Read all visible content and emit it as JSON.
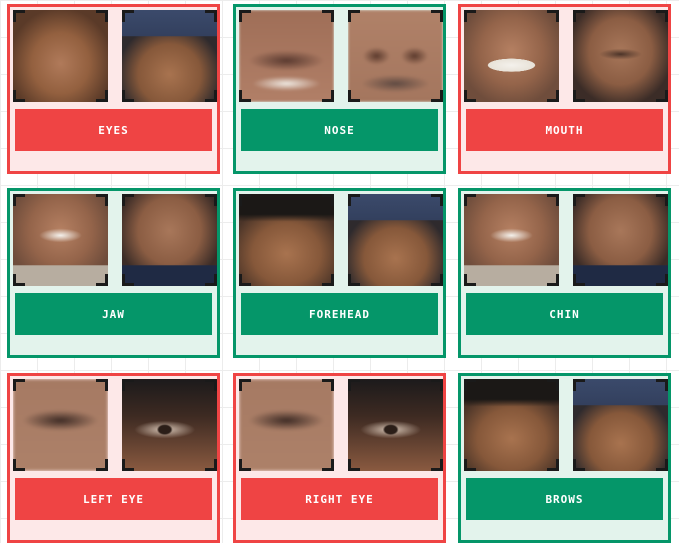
{
  "colors": {
    "wrong": "#ef4444",
    "correct": "#059669"
  },
  "cards": [
    {
      "label": "EYES",
      "state": "red",
      "left_photo": "face",
      "right_photo": "face-cap"
    },
    {
      "label": "NOSE",
      "state": "green",
      "left_photo": "mouth-blur",
      "right_photo": "nose-blur"
    },
    {
      "label": "MOUTH",
      "state": "red",
      "left_photo": "face-teeth",
      "right_photo": "face-stubble"
    },
    {
      "label": "JAW",
      "state": "green",
      "left_photo": "face-jaw-grey",
      "right_photo": "face-jaw-shirt"
    },
    {
      "label": "FOREHEAD",
      "state": "green",
      "left_photo": "face-hair",
      "right_photo": "face-cap"
    },
    {
      "label": "CHIN",
      "state": "green",
      "left_photo": "face-jaw-grey",
      "right_photo": "face-jaw-shirt"
    },
    {
      "label": "LEFT EYE",
      "state": "red",
      "left_photo": "eye-blur",
      "right_photo": "eye-dark"
    },
    {
      "label": "RIGHT EYE",
      "state": "red",
      "left_photo": "eye-blur",
      "right_photo": "eye-dark"
    },
    {
      "label": "BROWS",
      "state": "green",
      "left_photo": "face-hair",
      "right_photo": "face-cap"
    }
  ]
}
